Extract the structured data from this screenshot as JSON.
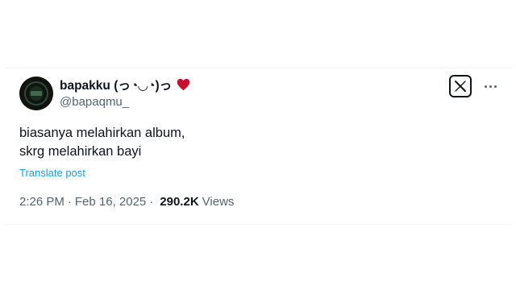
{
  "tweet": {
    "author": {
      "display_name": "bapakku (っ◔◡◔)っ",
      "handle": "@bapaqmu_",
      "heart_color": "#c8102e",
      "avatar_icon": "avatar-image"
    },
    "icons": {
      "brand": "x-logo-icon",
      "more": "more-options-icon"
    },
    "text_lines": [
      "biasanya melahirkan album,",
      "skrg melahirkan bayi"
    ],
    "translate_label": "Translate post",
    "time": "2:26 PM",
    "separator": "·",
    "date": "Feb 16, 2025",
    "views_count": "290.2K",
    "views_label": "Views"
  }
}
